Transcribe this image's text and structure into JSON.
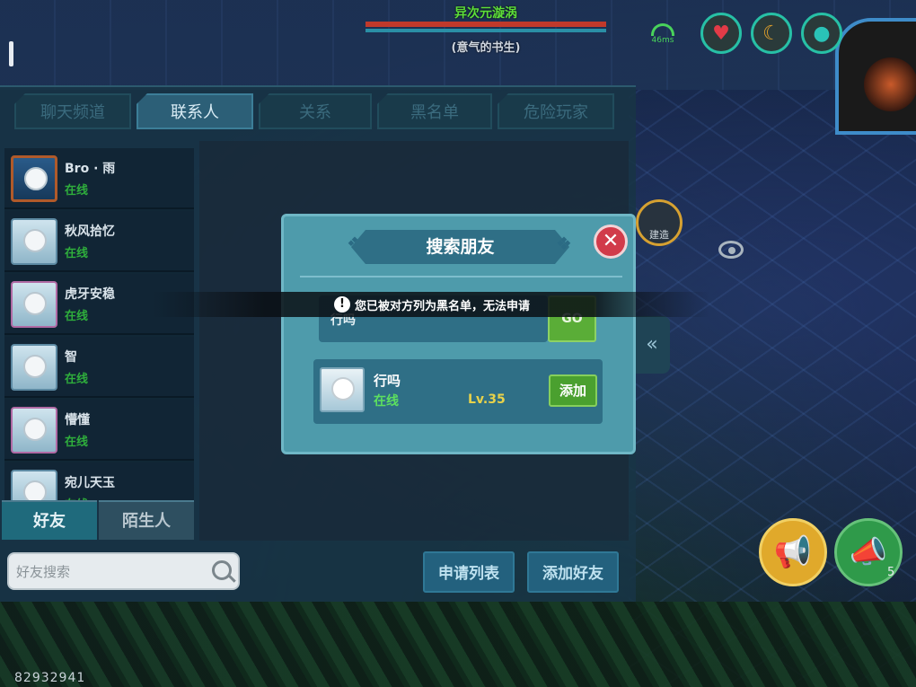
{
  "hud": {
    "boss_name": "异次元漩涡",
    "boss_subtitle": "(意气的书生)",
    "ping": "46ms",
    "stats": [
      {
        "icon": "heart-icon",
        "color": "#e23b47"
      },
      {
        "icon": "food-icon",
        "color": "#e8a42a"
      },
      {
        "icon": "water-drop-icon",
        "color": "#2ac3b7"
      }
    ]
  },
  "social": {
    "tabs": [
      {
        "label": "聊天频道",
        "active": false
      },
      {
        "label": "联系人",
        "active": true
      },
      {
        "label": "关系",
        "active": false
      },
      {
        "label": "黑名单",
        "active": false
      },
      {
        "label": "危险玩家",
        "active": false
      }
    ],
    "contacts": [
      {
        "name": "Bro · 雨",
        "status": "在线"
      },
      {
        "name": "秋风拾忆",
        "status": "在线"
      },
      {
        "name": "虎牙安稳",
        "status": "在线"
      },
      {
        "name": "智",
        "status": "在线"
      },
      {
        "name": "懵懂",
        "status": "在线"
      },
      {
        "name": "宛儿天玉",
        "status": "在线"
      }
    ],
    "bottom_tabs": [
      {
        "label": "好友",
        "active": true
      },
      {
        "label": "陌生人",
        "active": false
      }
    ],
    "search_placeholder": "好友搜索",
    "apply_list_label": "申请列表",
    "add_friend_label": "添加好友"
  },
  "side": {
    "build_label": "建造",
    "collapse_glyph": "«"
  },
  "dialog": {
    "title": "搜索朋友",
    "close_glyph": "✕",
    "search_value": "行吗",
    "go_label": "GO",
    "result": {
      "name": "行吗",
      "status": "在线",
      "level": "Lv.35",
      "add_label": "添加"
    }
  },
  "toast": {
    "icon": "!",
    "message": "您已被对方列为黑名单，无法申请"
  },
  "chat": {
    "horn_count": "5"
  },
  "player_id": "82932941"
}
